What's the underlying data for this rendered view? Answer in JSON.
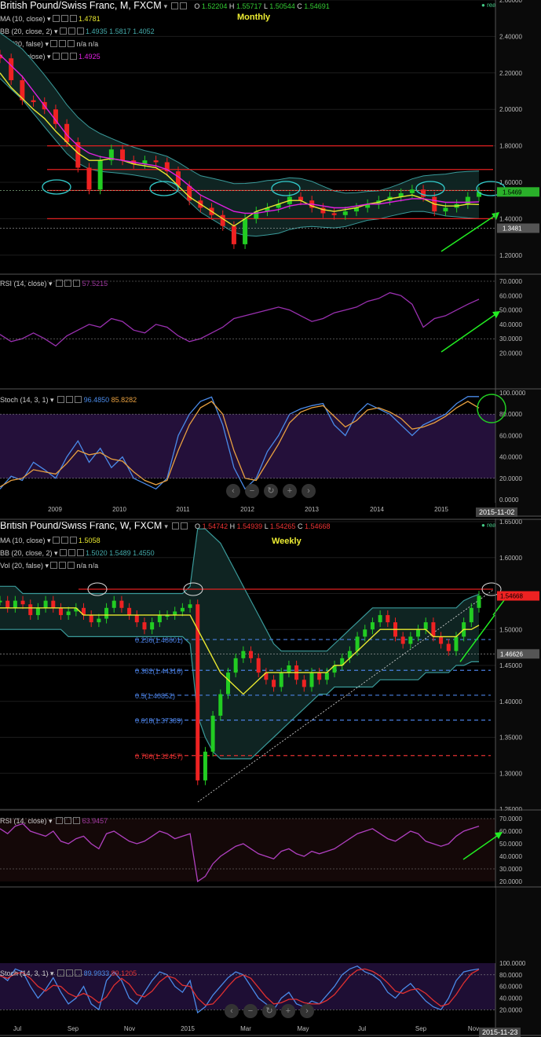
{
  "monthly": {
    "title": "British Pound/Swiss Franc, M, FXCM",
    "timeframe_label": "Monthly",
    "ohlc": {
      "o": "O",
      "o_val": "1.52204",
      "h": "H",
      "h_val": "1.55717",
      "l": "L",
      "l_val": "1.50544",
      "c": "C",
      "c_val": "1.54691"
    },
    "realtime": "realtime",
    "indicators": [
      {
        "name": "MA (10, close)",
        "values": "1.4781",
        "color": "#e8e830"
      },
      {
        "name": "BB (20, close, 2)",
        "values": "1.4935  1.5817  1.4052",
        "color": "#4aa"
      },
      {
        "name": "Vol (20, false)",
        "values": "n/a  n/a",
        "color": "#ccc"
      },
      {
        "name": "MA (21, close)",
        "values": "1.4925",
        "color": "#e020e0"
      }
    ],
    "price_labels": {
      "current": "1.5469",
      "line": "1.3481"
    },
    "rsi": {
      "name": "RSI (14, close)",
      "value": "57.5215"
    },
    "stoch": {
      "name": "Stoch (14, 3, 1)",
      "k": "96.4850",
      "d": "85.8282"
    },
    "date_label": "2015-11-02"
  },
  "weekly": {
    "title": "British Pound/Swiss Franc, W, FXCM",
    "timeframe_label": "Weekly",
    "ohlc": {
      "o": "O",
      "o_val": "1.54742",
      "h": "H",
      "h_val": "1.54939",
      "l": "L",
      "l_val": "1.54265",
      "c": "C",
      "c_val": "1.54668"
    },
    "realtime": "realtime",
    "indicators": [
      {
        "name": "MA (10, close)",
        "values": "1.5058",
        "color": "#e8e830"
      },
      {
        "name": "BB (20, close, 2)",
        "values": "1.5020  1.5489  1.4550",
        "color": "#4aa"
      },
      {
        "name": "Vol (20, false)",
        "values": "n/a  n/a",
        "color": "#ccc"
      }
    ],
    "price_labels": {
      "current": "1.54668",
      "line": "1.46626"
    },
    "fib_levels": [
      {
        "label": "0.236(1.48601)",
        "price": 1.48601,
        "color": "#4a7fe0"
      },
      {
        "label": "0.382(1.44316)",
        "price": 1.44316,
        "color": "#4a7fe0"
      },
      {
        "label": "0.5(1.40852)",
        "price": 1.40852,
        "color": "#4a7fe0"
      },
      {
        "label": "0.618(1.37389)",
        "price": 1.37389,
        "color": "#4a7fe0"
      },
      {
        "label": "0.786(1.32457)",
        "price": 1.32457,
        "color": "#e03030"
      }
    ],
    "rsi": {
      "name": "RSI (14, close)",
      "value": "63.9457"
    },
    "stoch": {
      "name": "Stoch (14, 3, 1)",
      "k": "89.9933",
      "d": "89.1205"
    },
    "date_label": "2015-11-23"
  },
  "chart_data": [
    {
      "type": "line",
      "title": "British Pound/Swiss Franc, M, FXCM",
      "ylim": [
        1.1,
        2.6
      ],
      "y_ticks": [
        "2.60000",
        "2.40000",
        "2.20000",
        "2.00000",
        "1.80000",
        "1.60000",
        "1.40000",
        "1.20000"
      ],
      "x_ticks": [
        "2009",
        "2010",
        "2011",
        "2012",
        "2013",
        "2014",
        "2015"
      ],
      "horizontal_lines": [
        1.8,
        1.67,
        1.555,
        1.4
      ],
      "series": [
        {
          "name": "GBPCHF close",
          "values": [
            2.28,
            2.16,
            2.05,
            2.04,
            2.0,
            1.92,
            1.82,
            1.68,
            1.56,
            1.72,
            1.78,
            1.72,
            1.7,
            1.72,
            1.71,
            1.66,
            1.58,
            1.5,
            1.46,
            1.42,
            1.36,
            1.26,
            1.4,
            1.44,
            1.46,
            1.48,
            1.52,
            1.5,
            1.46,
            1.43,
            1.42,
            1.44,
            1.46,
            1.48,
            1.5,
            1.52,
            1.54,
            1.56,
            1.52,
            1.44,
            1.46,
            1.48,
            1.52,
            1.547
          ]
        },
        {
          "name": "MA (10, close)",
          "values": [
            2.2,
            2.12,
            2.06,
            2.0,
            1.95,
            1.88,
            1.82,
            1.76,
            1.72,
            1.72,
            1.73,
            1.72,
            1.7,
            1.69,
            1.68,
            1.64,
            1.58,
            1.52,
            1.48,
            1.44,
            1.4,
            1.36,
            1.4,
            1.44,
            1.46,
            1.48,
            1.5,
            1.5,
            1.47,
            1.45,
            1.44,
            1.45,
            1.46,
            1.48,
            1.49,
            1.51,
            1.52,
            1.53,
            1.51,
            1.48,
            1.47,
            1.47,
            1.48,
            1.478
          ]
        },
        {
          "name": "MA (21, close)",
          "values": [
            2.3,
            2.24,
            2.18,
            2.1,
            2.02,
            1.94,
            1.86,
            1.8,
            1.76,
            1.74,
            1.73,
            1.72,
            1.71,
            1.7,
            1.69,
            1.67,
            1.63,
            1.58,
            1.53,
            1.5,
            1.47,
            1.44,
            1.43,
            1.43,
            1.44,
            1.45,
            1.47,
            1.48,
            1.48,
            1.47,
            1.46,
            1.46,
            1.47,
            1.48,
            1.48,
            1.49,
            1.5,
            1.51,
            1.51,
            1.5,
            1.49,
            1.49,
            1.49,
            1.4925
          ]
        }
      ]
    },
    {
      "type": "line",
      "title": "RSI (14, close) — Monthly",
      "ylim": [
        0,
        70
      ],
      "y_ticks": [
        "70.0000",
        "60.0000",
        "50.0000",
        "40.0000",
        "30.0000",
        "20.0000"
      ],
      "series": [
        {
          "name": "RSI",
          "values": [
            33,
            28,
            30,
            34,
            30,
            25,
            32,
            36,
            40,
            38,
            44,
            42,
            36,
            34,
            40,
            38,
            32,
            28,
            30,
            34,
            38,
            44,
            46,
            48,
            50,
            52,
            50,
            46,
            42,
            44,
            48,
            50,
            52,
            56,
            58,
            62,
            60,
            54,
            38,
            44,
            46,
            50,
            54,
            57.5
          ]
        }
      ]
    },
    {
      "type": "line",
      "title": "Stoch (14, 3, 1) — Monthly",
      "ylim": [
        0,
        100
      ],
      "y_ticks": [
        "100.0000",
        "80.0000",
        "60.0000",
        "40.0000",
        "20.0000",
        "0.0000"
      ],
      "series": [
        {
          "name": "%K",
          "values": [
            10,
            22,
            18,
            35,
            28,
            20,
            40,
            55,
            35,
            48,
            30,
            40,
            20,
            15,
            10,
            20,
            60,
            80,
            92,
            96,
            70,
            30,
            10,
            20,
            45,
            60,
            80,
            85,
            88,
            90,
            70,
            60,
            80,
            90,
            85,
            80,
            70,
            60,
            70,
            75,
            80,
            90,
            96.5,
            96.5
          ]
        },
        {
          "name": "%D",
          "values": [
            12,
            18,
            20,
            28,
            26,
            24,
            34,
            46,
            42,
            44,
            38,
            36,
            26,
            18,
            14,
            18,
            46,
            70,
            86,
            92,
            80,
            46,
            20,
            18,
            35,
            52,
            72,
            82,
            86,
            88,
            78,
            68,
            74,
            84,
            86,
            82,
            76,
            66,
            68,
            72,
            78,
            86,
            92,
            85.8
          ]
        }
      ]
    },
    {
      "type": "line",
      "title": "British Pound/Swiss Franc, W, FXCM",
      "ylim": [
        1.25,
        1.65
      ],
      "y_ticks": [
        "1.65000",
        "1.60000",
        "1.55000",
        "1.50000",
        "1.45000",
        "1.40000",
        "1.35000",
        "1.30000",
        "1.25000"
      ],
      "x_ticks": [
        "Jul",
        "Sep",
        "Nov",
        "2015",
        "Mar",
        "May",
        "Jul",
        "Sep",
        "Nov"
      ],
      "series": [
        {
          "name": "GBPCHF close",
          "values": [
            1.54,
            1.53,
            1.54,
            1.535,
            1.52,
            1.53,
            1.54,
            1.53,
            1.52,
            1.525,
            1.53,
            1.52,
            1.51,
            1.515,
            1.53,
            1.54,
            1.53,
            1.52,
            1.51,
            1.5,
            1.51,
            1.52,
            1.52,
            1.525,
            1.53,
            1.535,
            1.29,
            1.33,
            1.38,
            1.41,
            1.44,
            1.46,
            1.47,
            1.46,
            1.44,
            1.43,
            1.42,
            1.44,
            1.45,
            1.43,
            1.42,
            1.44,
            1.43,
            1.44,
            1.45,
            1.46,
            1.47,
            1.49,
            1.5,
            1.51,
            1.52,
            1.51,
            1.49,
            1.48,
            1.49,
            1.5,
            1.51,
            1.49,
            1.48,
            1.47,
            1.49,
            1.51,
            1.53,
            1.547
          ]
        },
        {
          "name": "MA (10, close)",
          "values": [
            1.53,
            1.53,
            1.53,
            1.53,
            1.53,
            1.53,
            1.53,
            1.53,
            1.53,
            1.53,
            1.53,
            1.52,
            1.52,
            1.52,
            1.52,
            1.52,
            1.52,
            1.52,
            1.52,
            1.52,
            1.52,
            1.52,
            1.52,
            1.52,
            1.52,
            1.52,
            1.5,
            1.48,
            1.46,
            1.44,
            1.43,
            1.42,
            1.41,
            1.42,
            1.43,
            1.44,
            1.44,
            1.44,
            1.44,
            1.44,
            1.44,
            1.44,
            1.44,
            1.44,
            1.45,
            1.45,
            1.46,
            1.47,
            1.48,
            1.49,
            1.5,
            1.5,
            1.5,
            1.5,
            1.5,
            1.5,
            1.5,
            1.49,
            1.49,
            1.49,
            1.49,
            1.5,
            1.5,
            1.506
          ]
        },
        {
          "name": "BB upper",
          "values": [
            1.56,
            1.56,
            1.56,
            1.55,
            1.55,
            1.55,
            1.55,
            1.55,
            1.55,
            1.55,
            1.55,
            1.55,
            1.55,
            1.55,
            1.55,
            1.55,
            1.55,
            1.55,
            1.55,
            1.55,
            1.55,
            1.55,
            1.55,
            1.55,
            1.55,
            1.56,
            1.64,
            1.64,
            1.63,
            1.62,
            1.6,
            1.58,
            1.56,
            1.54,
            1.52,
            1.5,
            1.48,
            1.47,
            1.47,
            1.47,
            1.47,
            1.47,
            1.47,
            1.47,
            1.48,
            1.49,
            1.5,
            1.51,
            1.52,
            1.53,
            1.53,
            1.53,
            1.53,
            1.53,
            1.53,
            1.53,
            1.53,
            1.53,
            1.53,
            1.53,
            1.53,
            1.54,
            1.545,
            1.549
          ]
        },
        {
          "name": "BB lower",
          "values": [
            1.5,
            1.5,
            1.5,
            1.5,
            1.5,
            1.5,
            1.5,
            1.5,
            1.5,
            1.49,
            1.49,
            1.49,
            1.49,
            1.49,
            1.49,
            1.49,
            1.49,
            1.49,
            1.49,
            1.49,
            1.49,
            1.49,
            1.49,
            1.49,
            1.49,
            1.48,
            1.38,
            1.35,
            1.33,
            1.32,
            1.32,
            1.32,
            1.32,
            1.32,
            1.33,
            1.34,
            1.35,
            1.36,
            1.37,
            1.38,
            1.39,
            1.4,
            1.41,
            1.41,
            1.42,
            1.42,
            1.42,
            1.42,
            1.42,
            1.42,
            1.43,
            1.43,
            1.43,
            1.43,
            1.43,
            1.43,
            1.44,
            1.44,
            1.44,
            1.44,
            1.45,
            1.45,
            1.455,
            1.455
          ]
        }
      ]
    },
    {
      "type": "line",
      "title": "RSI (14, close) — Weekly",
      "ylim": [
        20,
        70
      ],
      "y_ticks": [
        "70.0000",
        "60.0000",
        "50.0000",
        "40.0000",
        "30.0000",
        "20.0000"
      ],
      "series": [
        {
          "name": "RSI",
          "values": [
            62,
            58,
            64,
            66,
            60,
            58,
            56,
            60,
            52,
            50,
            54,
            56,
            50,
            46,
            58,
            60,
            56,
            52,
            50,
            52,
            56,
            60,
            58,
            54,
            56,
            58,
            20,
            24,
            34,
            40,
            44,
            48,
            50,
            46,
            42,
            40,
            38,
            44,
            46,
            42,
            40,
            44,
            42,
            44,
            46,
            50,
            54,
            58,
            60,
            62,
            58,
            54,
            52,
            56,
            60,
            58,
            52,
            50,
            48,
            50,
            56,
            60,
            62,
            64
          ]
        }
      ]
    },
    {
      "type": "line",
      "title": "Stoch (14, 3, 1) — Weekly",
      "ylim": [
        15,
        100
      ],
      "y_ticks": [
        "100.0000",
        "80.0000",
        "60.0000",
        "40.0000",
        "20.0000"
      ],
      "series": [
        {
          "name": "%K",
          "values": [
            80,
            70,
            90,
            85,
            60,
            40,
            55,
            75,
            50,
            30,
            40,
            60,
            30,
            20,
            70,
            85,
            70,
            40,
            30,
            50,
            70,
            85,
            80,
            60,
            50,
            70,
            15,
            25,
            45,
            60,
            75,
            85,
            80,
            60,
            40,
            30,
            20,
            40,
            50,
            30,
            25,
            35,
            30,
            45,
            60,
            80,
            90,
            95,
            85,
            80,
            70,
            50,
            40,
            55,
            65,
            50,
            35,
            25,
            20,
            40,
            70,
            85,
            88,
            90
          ]
        },
        {
          "name": "%D",
          "values": [
            78,
            74,
            82,
            84,
            74,
            60,
            52,
            62,
            60,
            48,
            42,
            48,
            42,
            32,
            42,
            62,
            74,
            64,
            46,
            42,
            52,
            68,
            78,
            74,
            62,
            60,
            40,
            28,
            30,
            44,
            60,
            74,
            80,
            74,
            58,
            42,
            30,
            32,
            38,
            38,
            32,
            30,
            30,
            36,
            46,
            62,
            78,
            88,
            90,
            86,
            78,
            66,
            52,
            48,
            54,
            56,
            48,
            36,
            26,
            30,
            46,
            66,
            82,
            89
          ]
        }
      ]
    }
  ]
}
